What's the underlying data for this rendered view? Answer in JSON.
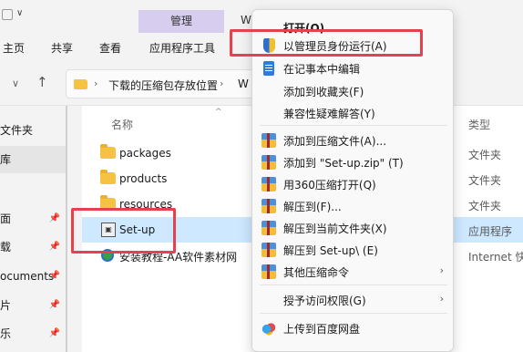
{
  "titlebar": {
    "manage_tab": "管理",
    "window_title_fragment": "W"
  },
  "ribbon": {
    "tabs": [
      "主页",
      "共享",
      "查看",
      "应用程序工具"
    ]
  },
  "address": {
    "crumb": "下载的压缩包存放位置",
    "crumb2": "W"
  },
  "sidebar": {
    "items": [
      {
        "label": "文件夹",
        "selected": false,
        "pinned": false
      },
      {
        "label": "库",
        "selected": true,
        "pinned": false
      },
      {
        "label": "面",
        "selected": false,
        "pinned": true
      },
      {
        "label": "载",
        "selected": false,
        "pinned": true
      },
      {
        "label": "ocuments",
        "selected": false,
        "pinned": true
      },
      {
        "label": "片",
        "selected": false,
        "pinned": true
      },
      {
        "label": "乐",
        "selected": false,
        "pinned": true
      }
    ]
  },
  "filepane": {
    "col_name": "名称",
    "col_type": "类型",
    "rows": [
      {
        "name": "packages",
        "type": "文件夹",
        "icon": "folder-icon",
        "selected": false
      },
      {
        "name": "products",
        "type": "文件夹",
        "icon": "folder-icon",
        "selected": false
      },
      {
        "name": "resources",
        "type": "文件夹",
        "icon": "folder-icon",
        "selected": false
      },
      {
        "name": "Set-up",
        "type": "应用程序",
        "icon": "setup-exe-icon",
        "selected": true
      },
      {
        "name": "安装教程-AA软件素材网",
        "type": "Internet 快",
        "icon": "internet-shortcut-icon",
        "selected": false
      }
    ]
  },
  "context_menu": {
    "items": [
      {
        "label": "打开(O)",
        "icon": "",
        "bold": true,
        "submenu": false
      },
      {
        "label": "以管理员身份运行(A)",
        "icon": "admin-shield-icon",
        "bold": false,
        "submenu": false
      },
      {
        "label": "在记事本中编辑",
        "icon": "notepad-icon",
        "bold": false,
        "submenu": false
      },
      {
        "label": "添加到收藏夹(F)",
        "icon": "",
        "bold": false,
        "submenu": false
      },
      {
        "label": "兼容性疑难解答(Y)",
        "icon": "",
        "bold": false,
        "submenu": false
      },
      {
        "label": "添加到压缩文件(A)...",
        "icon": "archive-icon",
        "bold": false,
        "submenu": false
      },
      {
        "label": "添加到 \"Set-up.zip\" (T)",
        "icon": "archive-icon",
        "bold": false,
        "submenu": false
      },
      {
        "label": "用360压缩打开(Q)",
        "icon": "archive-icon",
        "bold": false,
        "submenu": false
      },
      {
        "label": "解压到(F)...",
        "icon": "archive-icon",
        "bold": false,
        "submenu": false
      },
      {
        "label": "解压到当前文件夹(X)",
        "icon": "archive-icon",
        "bold": false,
        "submenu": false
      },
      {
        "label": "解压到 Set-up\\ (E)",
        "icon": "archive-icon",
        "bold": false,
        "submenu": false
      },
      {
        "label": "其他压缩命令",
        "icon": "archive-icon",
        "bold": false,
        "submenu": true
      },
      {
        "label": "授予访问权限(G)",
        "icon": "",
        "bold": false,
        "submenu": true
      },
      {
        "label": "上传到百度网盘",
        "icon": "baidu-cloud-icon",
        "bold": false,
        "submenu": false
      }
    ]
  },
  "colors": {
    "accent_highlight": "#e5434b",
    "selection": "#cde8ff",
    "manage_tab": "#d6cdef"
  }
}
